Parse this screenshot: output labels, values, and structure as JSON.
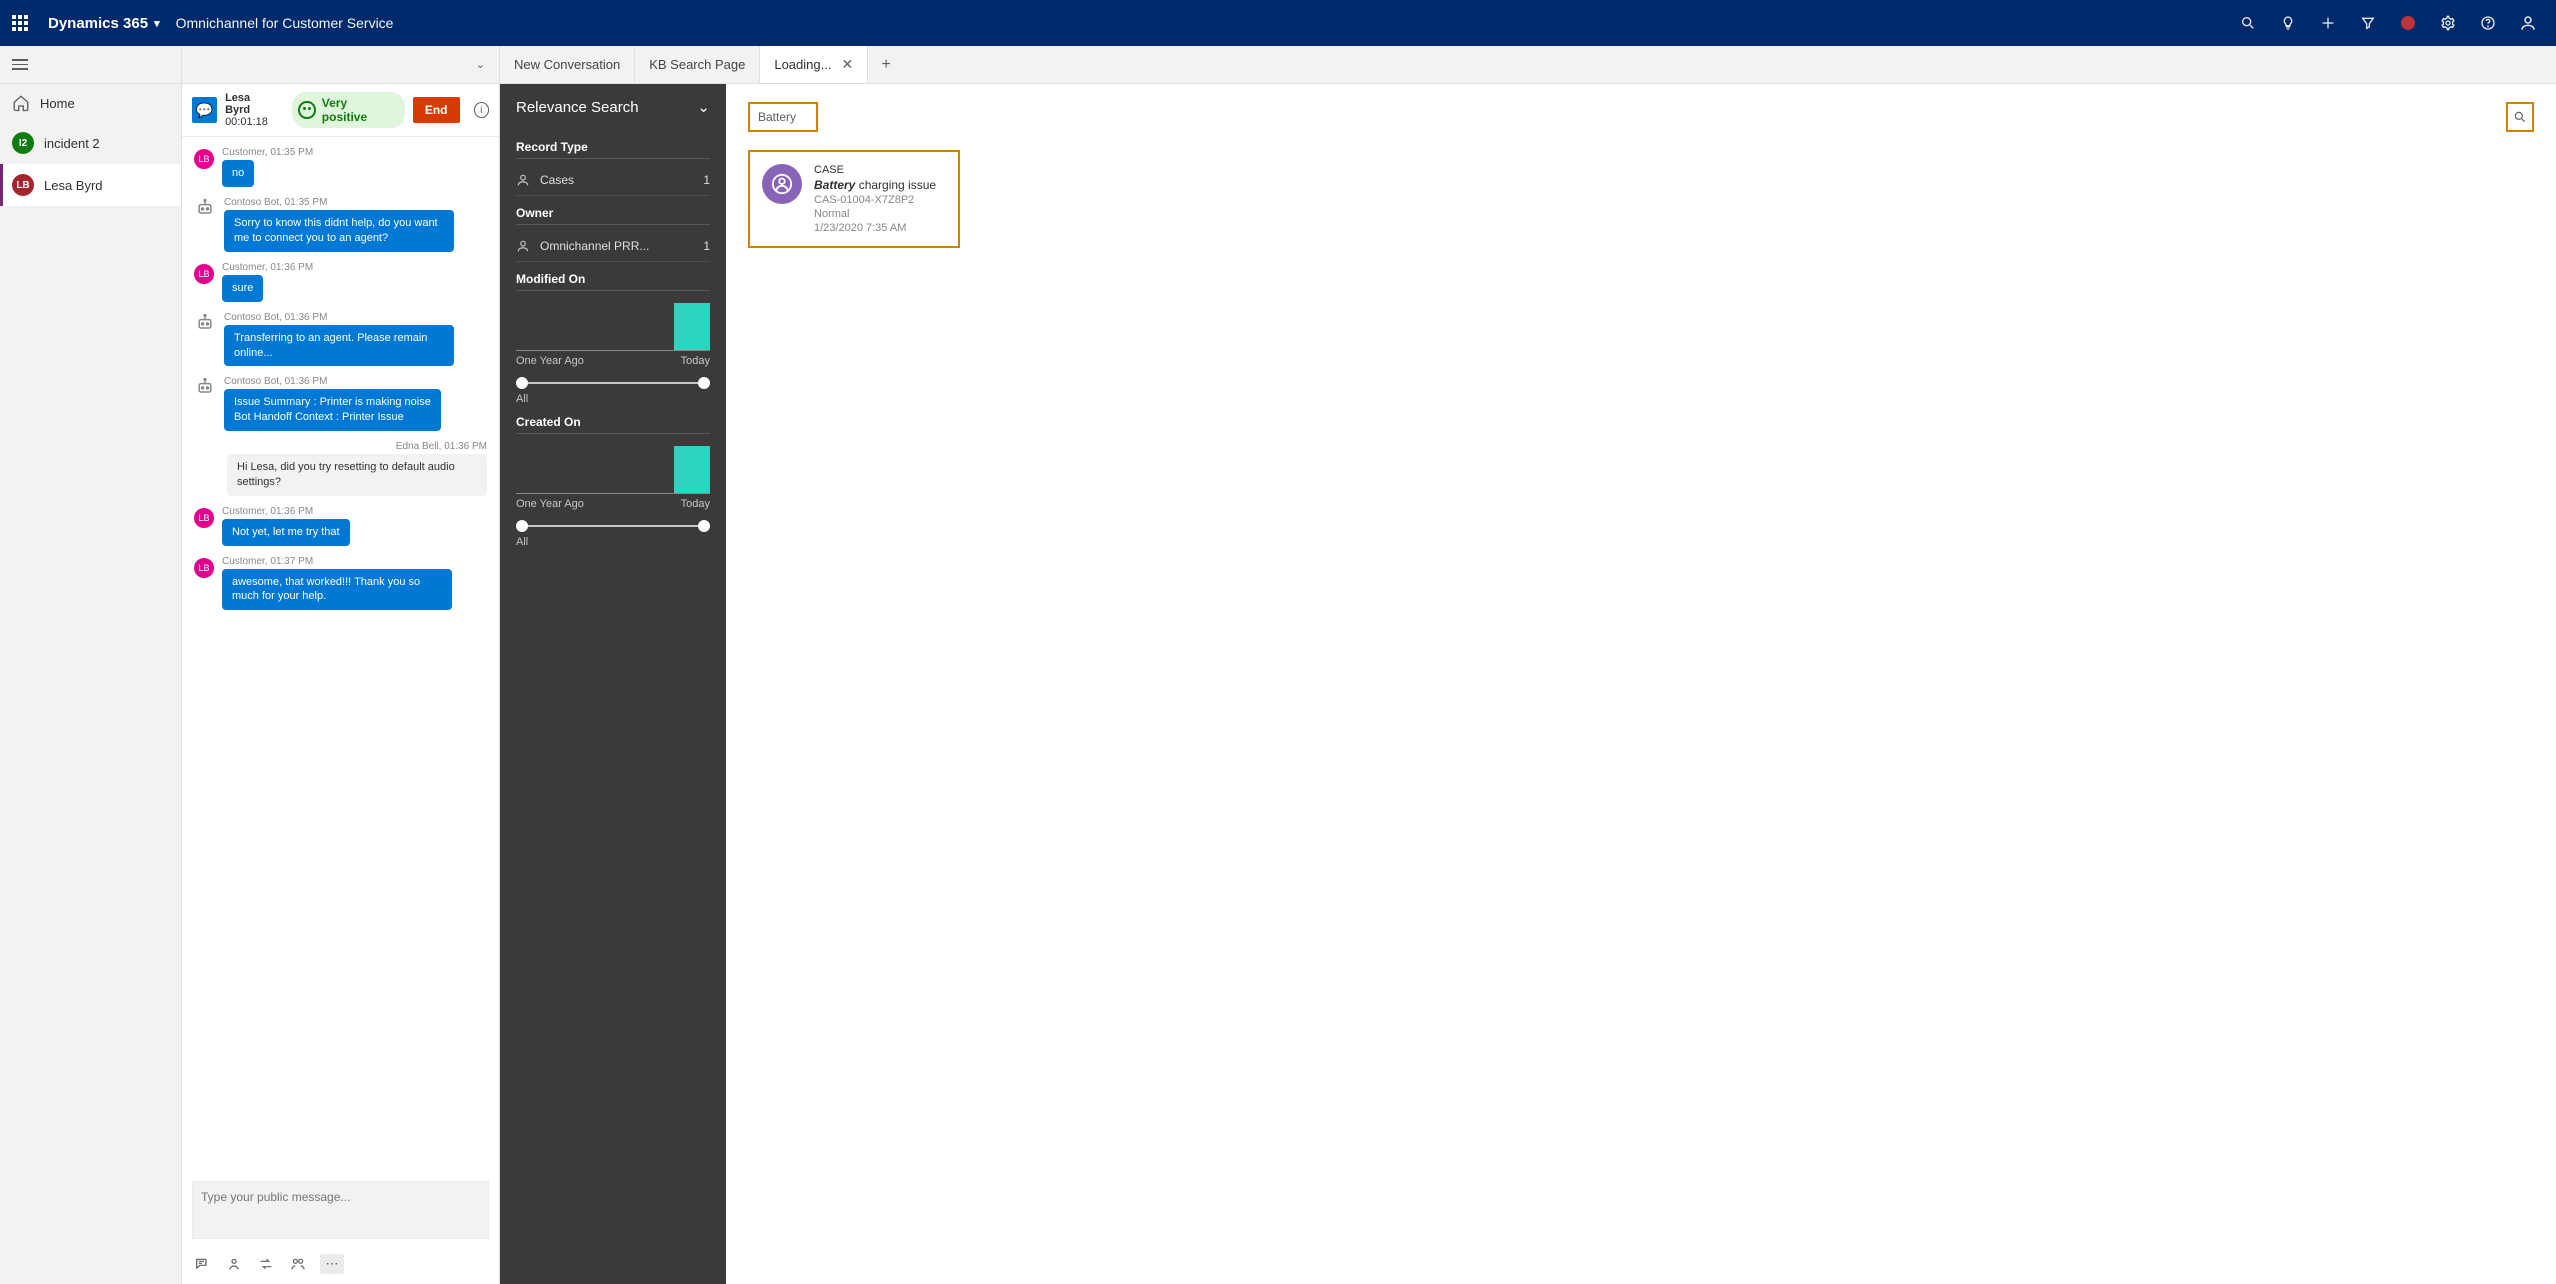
{
  "topbar": {
    "brand": "Dynamics 365",
    "app_name": "Omnichannel for Customer Service"
  },
  "sidebar": {
    "items": [
      {
        "label": "Home"
      },
      {
        "label": "incident 2",
        "badge": "I2"
      },
      {
        "label": "Lesa Byrd",
        "badge": "LB"
      }
    ]
  },
  "tabs": [
    {
      "label": "New Conversation"
    },
    {
      "label": "KB Search Page"
    },
    {
      "label": "Loading..."
    }
  ],
  "conversation": {
    "header": {
      "name": "Lesa Byrd",
      "timer": "00:01:18",
      "sentiment": "Very positive",
      "end": "End"
    },
    "messages": [
      {
        "who": "customer",
        "badge": "LB",
        "meta": "Customer, 01:35 PM",
        "text": "no"
      },
      {
        "who": "bot",
        "meta": "Contoso Bot, 01:35 PM",
        "text": "Sorry to know this didnt help, do you want me to connect you to an agent?"
      },
      {
        "who": "customer",
        "badge": "LB",
        "meta": "Customer, 01:36 PM",
        "text": "sure"
      },
      {
        "who": "bot",
        "meta": "Contoso Bot, 01:36 PM",
        "text": "Transferring to an agent. Please remain online..."
      },
      {
        "who": "bot",
        "meta": "Contoso Bot, 01:36 PM",
        "text": "Issue Summary : Printer is making noise\nBot Handoff Context : Printer Issue"
      },
      {
        "who": "agent",
        "meta": "Edna Bell,  01:36 PM",
        "text": "Hi Lesa, did you try resetting to default audio settings?"
      },
      {
        "who": "customer",
        "badge": "LB",
        "meta": "Customer, 01:36 PM",
        "text": "Not yet, let me try that"
      },
      {
        "who": "customer",
        "badge": "LB",
        "meta": "Customer, 01:37 PM",
        "text": "awesome, that worked!!! Thank you so much for your help."
      }
    ],
    "input_placeholder": "Type your public message..."
  },
  "relevance": {
    "title": "Relevance Search",
    "sections": {
      "record_type": {
        "label": "Record Type",
        "rows": [
          {
            "label": "Cases",
            "count": "1"
          }
        ]
      },
      "owner": {
        "label": "Owner",
        "rows": [
          {
            "label": "Omnichannel PRR...",
            "count": "1"
          }
        ]
      },
      "modified_on": {
        "label": "Modified On",
        "range_left": "One Year Ago",
        "range_right": "Today",
        "all": "All"
      },
      "created_on": {
        "label": "Created On",
        "range_left": "One Year Ago",
        "range_right": "Today",
        "all": "All"
      }
    }
  },
  "search": {
    "query": "Battery"
  },
  "result": {
    "type": "CASE",
    "title_bold": "Battery",
    "title_rest": " charging issue",
    "case_number": "CAS-01004-X7Z8P2",
    "priority": "Normal",
    "date": "1/23/2020 7:35 AM"
  },
  "chart_data": [
    {
      "type": "bar",
      "title": "Modified On",
      "categories": [
        "b1",
        "b2",
        "b3",
        "b4",
        "b5"
      ],
      "values": [
        0,
        0,
        0,
        0,
        1
      ],
      "xlabel_left": "One Year Ago",
      "xlabel_right": "Today",
      "ylim": [
        0,
        1
      ]
    },
    {
      "type": "bar",
      "title": "Created On",
      "categories": [
        "b1",
        "b2",
        "b3",
        "b4",
        "b5"
      ],
      "values": [
        0,
        0,
        0,
        0,
        1
      ],
      "xlabel_left": "One Year Ago",
      "xlabel_right": "Today",
      "ylim": [
        0,
        1
      ]
    }
  ]
}
